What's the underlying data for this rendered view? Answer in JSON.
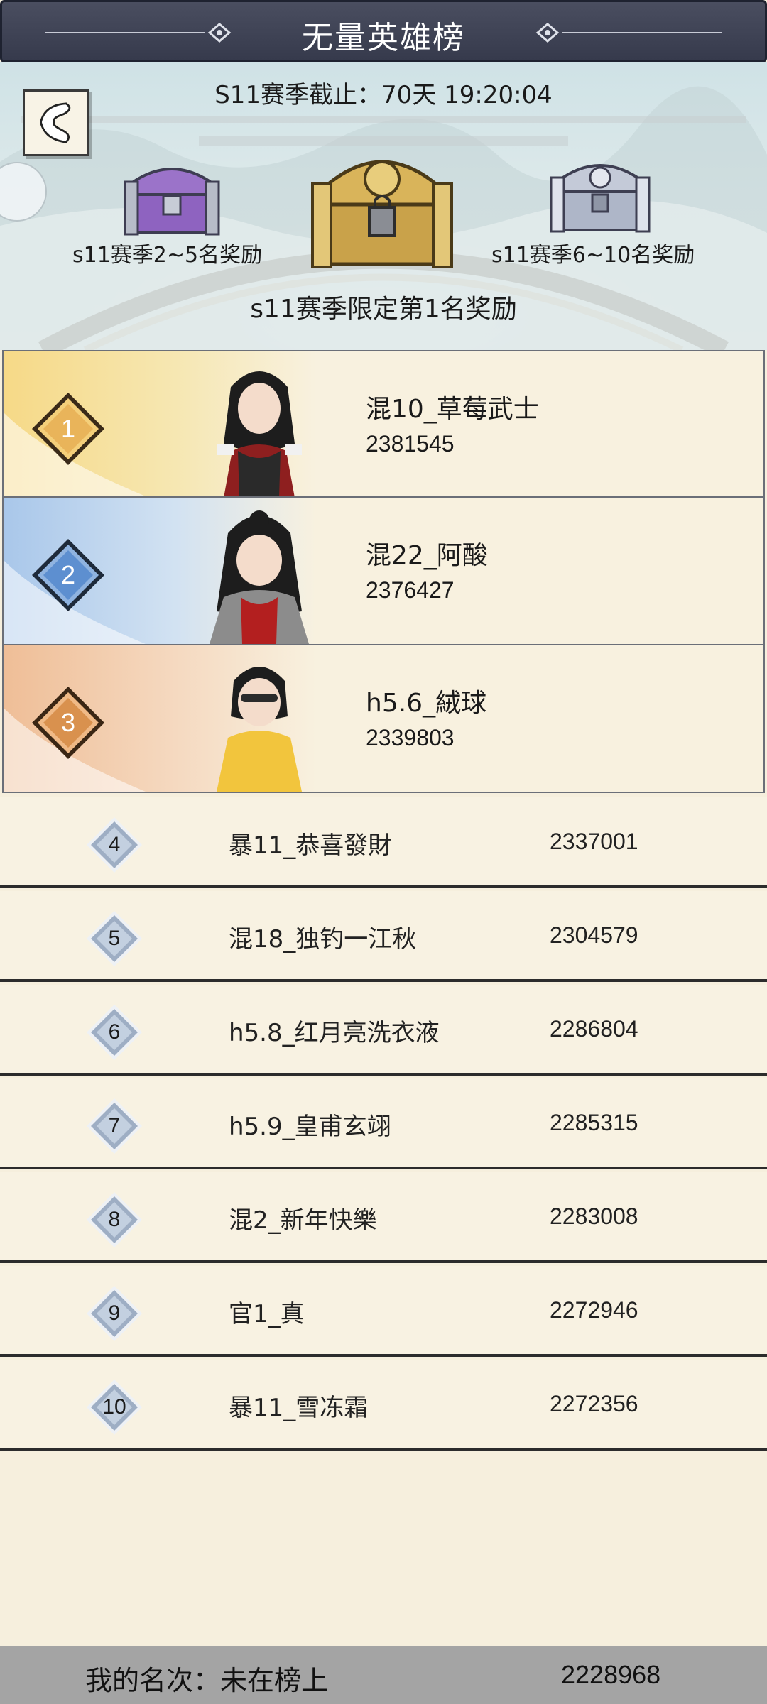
{
  "header": {
    "title": "无量英雄榜",
    "season_timer": "S11赛季截止：70天 19:20:04"
  },
  "rewards": {
    "rank2_5_label": "s11赛季2~5名奖励",
    "rank1_label": "s11赛季限定第1名奖励",
    "rank6_10_label": "s11赛季6~10名奖励"
  },
  "top3": [
    {
      "rank": "1",
      "name": "混10_草莓武士",
      "score": "2381545"
    },
    {
      "rank": "2",
      "name": "混22_阿酸",
      "score": "2376427"
    },
    {
      "rank": "3",
      "name": "h5.6_絨球",
      "score": "2339803"
    }
  ],
  "ranking": [
    {
      "rank": "4",
      "name": "暴11_恭喜發財",
      "score": "2337001"
    },
    {
      "rank": "5",
      "name": "混18_独钓一江秋",
      "score": "2304579"
    },
    {
      "rank": "6",
      "name": "h5.8_红月亮洗衣液",
      "score": "2286804"
    },
    {
      "rank": "7",
      "name": "h5.9_皇甫玄翊",
      "score": "2285315"
    },
    {
      "rank": "8",
      "name": "混2_新年快樂",
      "score": "2283008"
    },
    {
      "rank": "9",
      "name": "官1_真",
      "score": "2272946"
    },
    {
      "rank": "10",
      "name": "暴11_雪冻霜",
      "score": "2272356"
    }
  ],
  "my_rank": {
    "label": "我的名次：未在榜上",
    "score": "2228968"
  },
  "colors": {
    "title_bar": "#3f4356",
    "rank1": "#f6d987",
    "rank2": "#a9c7ea",
    "rank3": "#efbe97",
    "list_bg": "#f8f2e2",
    "footer": "#a4a4a4"
  },
  "icons": {
    "back": "back-arrow-icon",
    "chest_purple": "purple-chest-icon",
    "chest_gold": "gold-chest-icon",
    "chest_silver": "silver-chest-icon"
  }
}
